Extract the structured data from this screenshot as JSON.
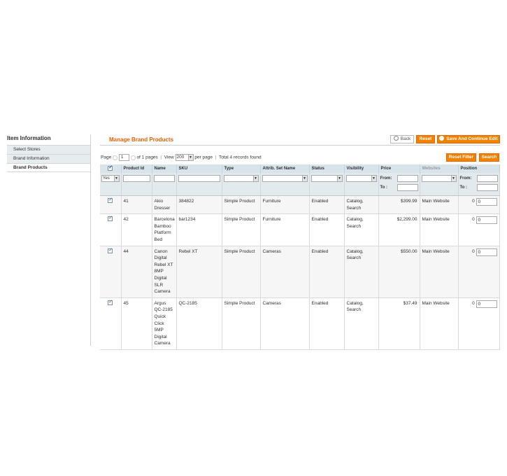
{
  "sidebar": {
    "title": "Item Information",
    "items": [
      {
        "label": "Select Stores"
      },
      {
        "label": "Brand Information"
      },
      {
        "label": "Brand Products"
      }
    ]
  },
  "header": {
    "title": "Manage Brand Products",
    "back_label": "Back",
    "reset_label": "Reset",
    "save_continue_label": "Save And Continue Edit"
  },
  "pager": {
    "page_label": "Page",
    "page_value": "1",
    "of_pages": "of 1 pages",
    "view_label": "View",
    "per_page_value": "200",
    "per_page_label": "per page",
    "records": "Total 4 records found",
    "reset_filter_label": "Reset Filter",
    "search_label": "Search"
  },
  "grid": {
    "columns": [
      "Product Id",
      "Name",
      "SKU",
      "Type",
      "Attrib. Set Name",
      "Status",
      "Visibility",
      "Price",
      "Websites",
      "Position"
    ],
    "filter": {
      "in_products_value": "Yes",
      "from_label": "From:",
      "to_label": "To :"
    },
    "rows": [
      {
        "id": "41",
        "name": "Akio Dresser",
        "sku": "384822",
        "type": "Simple Product",
        "attrib": "Furniture",
        "status": "Enabled",
        "visibility": "Catalog, Search",
        "price": "$399.99",
        "website": "Main Website",
        "position_label": "0",
        "position_value": "0"
      },
      {
        "id": "42",
        "name": "Barcelona Bamboo Platform Bed",
        "sku": "bar1234",
        "type": "Simple Product",
        "attrib": "Furniture",
        "status": "Enabled",
        "visibility": "Catalog, Search",
        "price": "$2,299.00",
        "website": "Main Website",
        "position_label": "0",
        "position_value": "0"
      },
      {
        "id": "44",
        "name": "Canon Digital Rebel XT 8MP Digital SLR Camera",
        "sku": "Rebel XT",
        "type": "Simple Product",
        "attrib": "Cameras",
        "status": "Enabled",
        "visibility": "Catalog, Search",
        "price": "$550.00",
        "website": "Main Website",
        "position_label": "0",
        "position_value": "0"
      },
      {
        "id": "45",
        "name": "Argus QC-2185 Quick Click 5MP Digital Camera",
        "sku": "QC-2185",
        "type": "Simple Product",
        "attrib": "Cameras",
        "status": "Enabled",
        "visibility": "Catalog, Search",
        "price": "$37.49",
        "website": "Main Website",
        "position_label": "0",
        "position_value": "0"
      }
    ]
  },
  "colors": {
    "accent": "#eb5e00",
    "button": "#f18200",
    "header_bg": "#d9e3ea"
  }
}
